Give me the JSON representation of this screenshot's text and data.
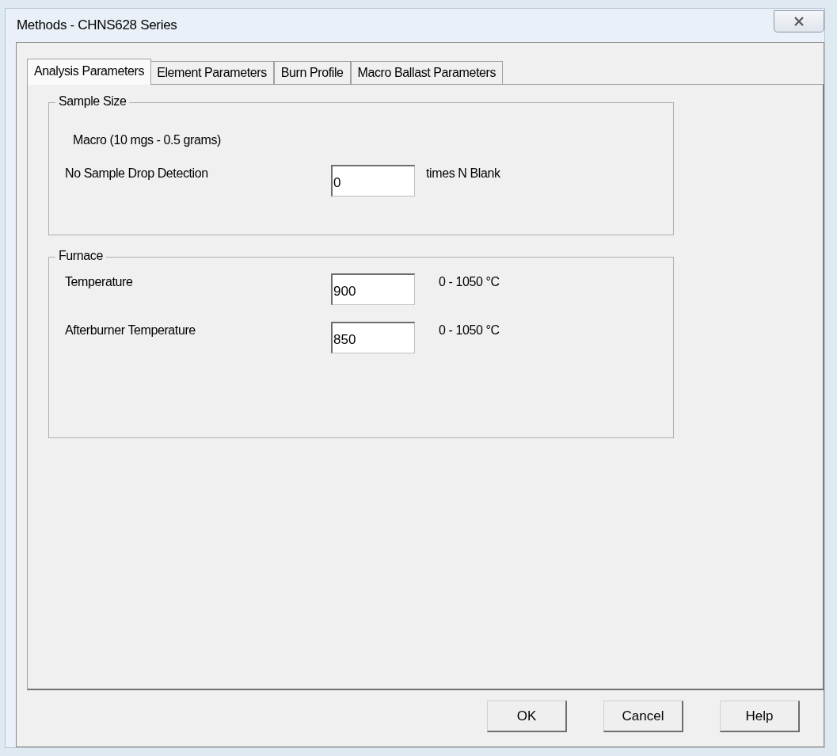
{
  "window": {
    "title": "Methods - CHNS628 Series"
  },
  "tabs": [
    {
      "label": "Analysis Parameters",
      "selected": true
    },
    {
      "label": "Element Parameters",
      "selected": false
    },
    {
      "label": "Burn Profile",
      "selected": false
    },
    {
      "label": "Macro Ballast Parameters",
      "selected": false
    }
  ],
  "groups": [
    {
      "title": "Sample Size",
      "rows": [
        {
          "kind": "text",
          "label": "Macro (10 mgs - 0.5 grams)"
        },
        {
          "kind": "field",
          "label": "No Sample Drop Detection",
          "value": "0",
          "unit": "times N Blank"
        }
      ]
    },
    {
      "title": "Furnace",
      "rows": [
        {
          "kind": "field",
          "label": "Temperature",
          "value": "900",
          "unit": "0 - 1050 °C"
        },
        {
          "kind": "field",
          "label": "Afterburner Temperature",
          "value": "850",
          "unit": "0 - 1050 °C"
        }
      ]
    }
  ],
  "buttons": [
    "OK",
    "Cancel",
    "Help"
  ]
}
